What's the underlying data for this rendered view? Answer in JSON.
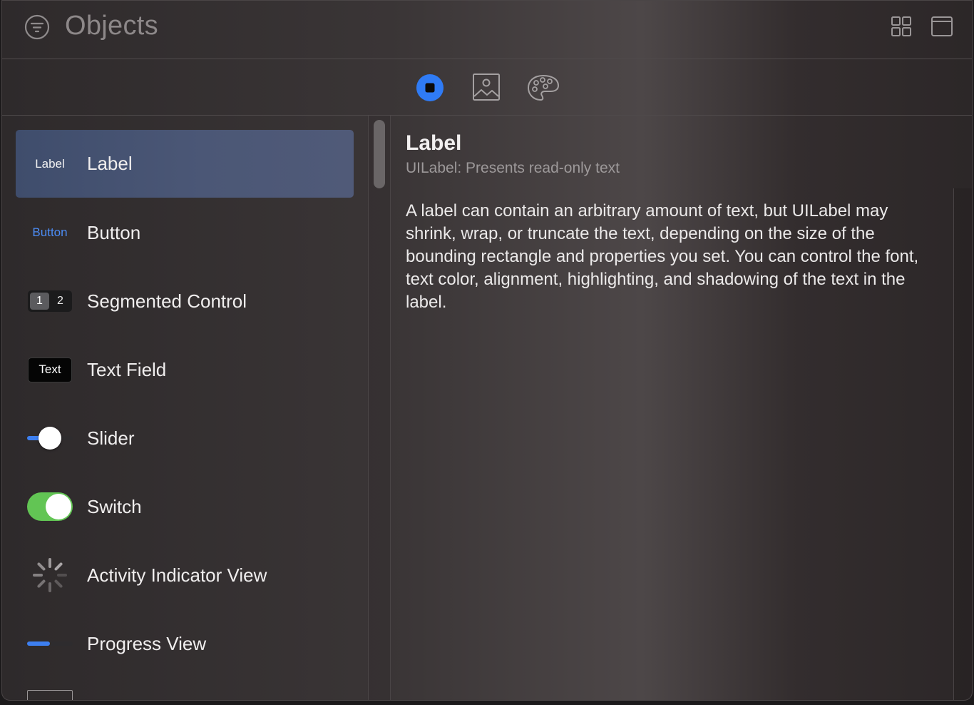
{
  "header": {
    "title": "Objects",
    "filter_icon": "filter-icon",
    "grid_icon": "grid-view-icon",
    "window_icon": "window-icon"
  },
  "segments": [
    {
      "name": "objects",
      "icon": "square-in-circle-icon",
      "selected": true
    },
    {
      "name": "images",
      "icon": "photo-icon",
      "selected": false
    },
    {
      "name": "colors",
      "icon": "palette-icon",
      "selected": false
    }
  ],
  "list": {
    "items": [
      {
        "label": "Label",
        "thumb_text": "Label",
        "selected": true
      },
      {
        "label": "Button",
        "thumb_text": "Button",
        "selected": false
      },
      {
        "label": "Segmented Control",
        "thumb_seg": [
          "1",
          "2"
        ],
        "selected": false
      },
      {
        "label": "Text Field",
        "thumb_text": "Text",
        "selected": false
      },
      {
        "label": "Slider",
        "thumb_value": 0.5,
        "selected": false
      },
      {
        "label": "Switch",
        "thumb_state": "on",
        "selected": false
      },
      {
        "label": "Activity Indicator View",
        "selected": false
      },
      {
        "label": "Progress View",
        "thumb_value": 0.5,
        "selected": false
      }
    ]
  },
  "detail": {
    "title": "Label",
    "subtitle": "UILabel: Presents read-only text",
    "description": "A label can contain an arbitrary amount of text, but UILabel may shrink, wrap, or truncate the text, depending on the size of the bounding rectangle and properties you set. You can control the font, text color, alignment, highlighting, and shadowing of the text in the label."
  },
  "colors": {
    "accent": "#2f7bf5",
    "selection": "#4a5675",
    "switch_on": "#62c554",
    "button_text": "#4c8df6"
  }
}
